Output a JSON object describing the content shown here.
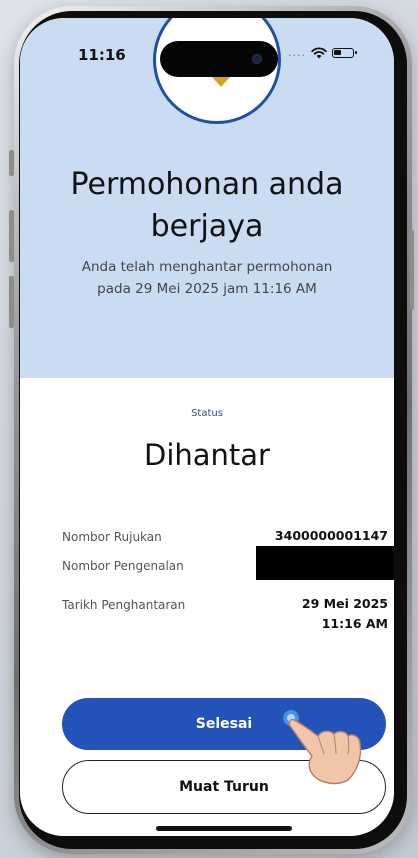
{
  "status_bar": {
    "time": "11:16",
    "signal_dots": "....",
    "wifi_icon": "wifi-icon",
    "battery_icon": "battery-icon"
  },
  "header": {
    "badge_icon": "success-badge-icon",
    "title": "Permohonan anda berjaya",
    "subtitle": "Anda telah menghantar permohonan pada 29 Mei 2025 jam 11:16 AM"
  },
  "status": {
    "label": "Status",
    "value": "Dihantar"
  },
  "details": {
    "reference_label": "Nombor Rujukan",
    "reference_value": "3400000001147",
    "id_label": "Nombor Pengenalan",
    "date_label": "Tarikh Penghantaran",
    "date_value": "29 Mei 2025",
    "time_value": "11:16 AM"
  },
  "actions": {
    "done_label": "Selesai",
    "download_label": "Muat Turun"
  },
  "colors": {
    "primary": "#2353b8",
    "header_bg": "#c9dcf2",
    "badge_border": "#1f4fa8",
    "accent": "#d8a31c"
  }
}
